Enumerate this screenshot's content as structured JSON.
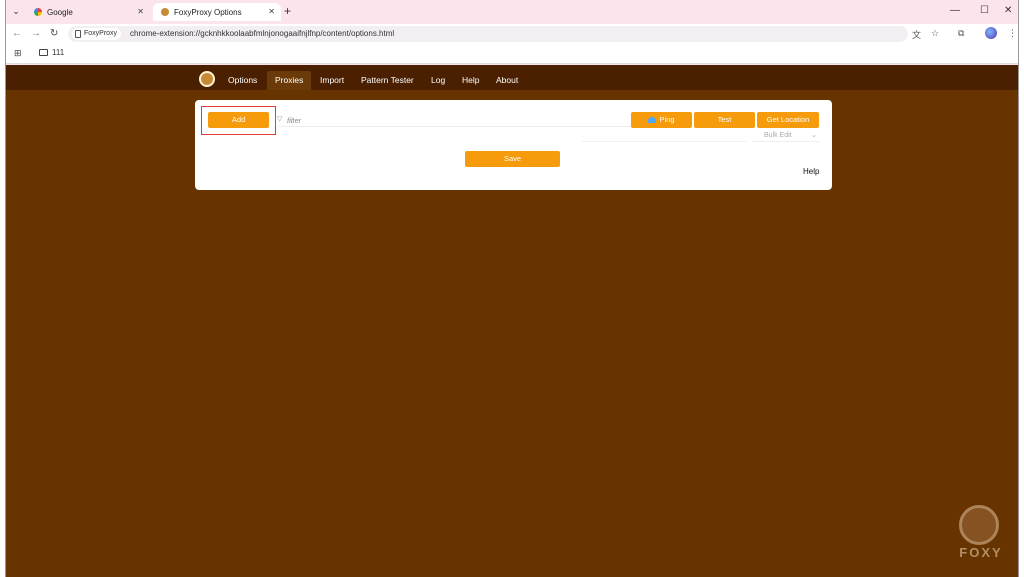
{
  "tabs": [
    {
      "title": "Google"
    },
    {
      "title": "FoxyProxy Options"
    }
  ],
  "toolbar": {
    "chip_label": "FoxyProxy",
    "url": "chrome-extension://gcknhkkoolaabfmlnjonogaaifnjlfnp/content/options.html"
  },
  "bookmarks": {
    "folder_label": "111"
  },
  "nav": {
    "items": [
      "Options",
      "Proxies",
      "Import",
      "Pattern Tester",
      "Log",
      "Help",
      "About"
    ],
    "active": "Proxies"
  },
  "proxies": {
    "add_label": "Add",
    "filter_placeholder": "filter",
    "ping_label": "Ping",
    "test_label": "Test",
    "location_label": "Get Location",
    "bulk_edit_label": "Bulk Edit",
    "save_label": "Save",
    "help_label": "Help"
  },
  "watermark": {
    "text": "FOXY"
  },
  "colors": {
    "page_bg": "#673400",
    "navbar_bg": "#4a2000",
    "accent": "#f59b0c",
    "highlight_box": "#e23b3b"
  },
  "icons": [
    "search-icon",
    "close-icon",
    "new-tab-icon",
    "minimize-icon",
    "maximize-icon",
    "back-icon",
    "forward-icon",
    "reload-icon",
    "translate-icon",
    "star-icon",
    "extensions-icon",
    "menu-icon",
    "apps-icon",
    "folder-icon",
    "foxyproxy-logo-icon",
    "filter-icon",
    "wifi-icon"
  ]
}
